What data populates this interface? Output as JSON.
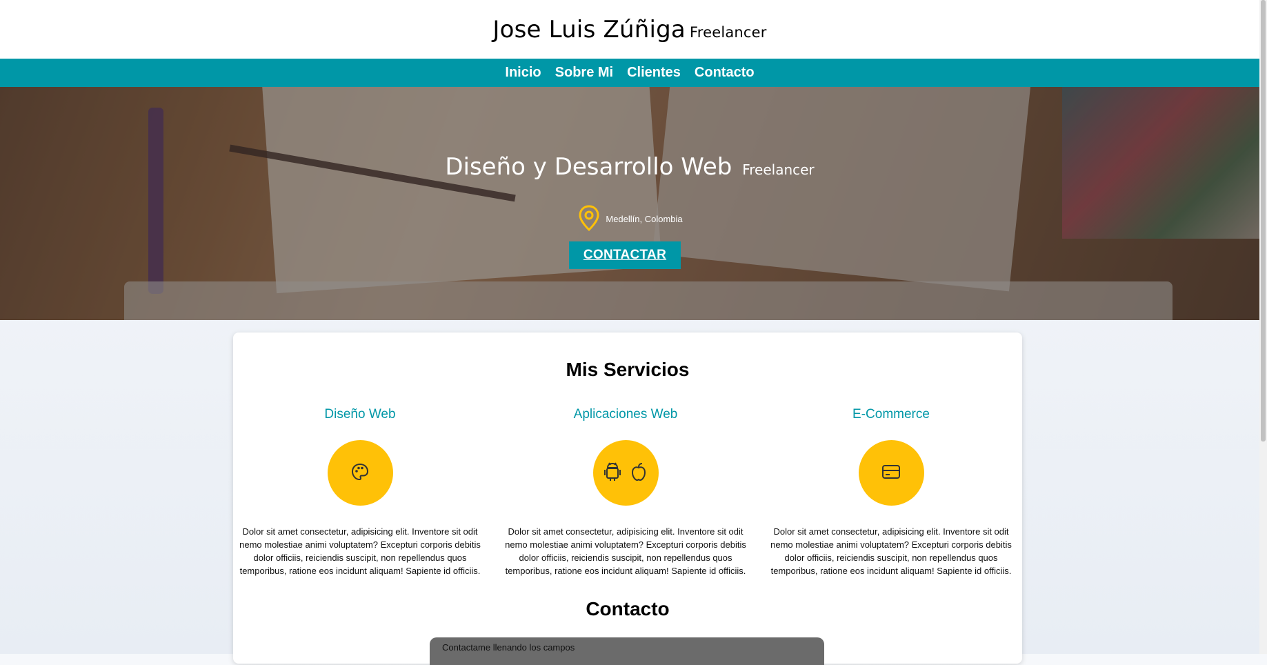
{
  "header": {
    "name": "Jose Luis Zúñiga",
    "role": "Freelancer"
  },
  "nav": {
    "items": [
      "Inicio",
      "Sobre Mi",
      "Clientes",
      "Contacto"
    ]
  },
  "hero": {
    "title": "Diseño y Desarrollo Web",
    "subtitle": "Freelancer",
    "location": "Medellín, Colombia",
    "location_icon": "map-pin-icon",
    "cta_label": "CONTACTAR"
  },
  "services": {
    "title": "Mis Servicios",
    "items": [
      {
        "name": "Diseño Web",
        "icon": "palette-icon",
        "description": "Dolor sit amet consectetur, adipisicing elit. Inventore sit odit nemo molestiae animi voluptatem? Excepturi corporis debitis dolor officiis, reiciendis suscipit, non repellendus quos temporibus, ratione eos incidunt aliquam! Sapiente id officiis."
      },
      {
        "name": "Aplicaciones Web",
        "icon": "android-apple-icon",
        "description": "Dolor sit amet consectetur, adipisicing elit. Inventore sit odit nemo molestiae animi voluptatem? Excepturi corporis debitis dolor officiis, reiciendis suscipit, non repellendus quos temporibus, ratione eos incidunt aliquam! Sapiente id officiis."
      },
      {
        "name": "E-Commerce",
        "icon": "credit-card-icon",
        "description": "Dolor sit amet consectetur, adipisicing elit. Inventore sit odit nemo molestiae animi voluptatem? Excepturi corporis debitis dolor officiis, reiciendis suscipit, non repellendus quos temporibus, ratione eos incidunt aliquam! Sapiente id officiis."
      }
    ]
  },
  "contact": {
    "title": "Contacto",
    "form_legend": "Contactame llenando los campos"
  },
  "colors": {
    "accent": "#0097a7",
    "highlight": "#ffc107"
  }
}
